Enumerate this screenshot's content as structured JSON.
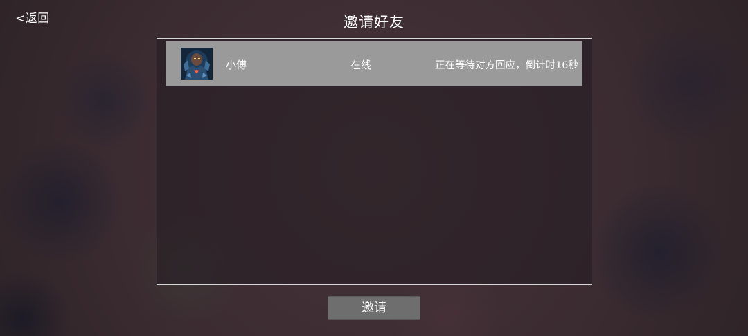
{
  "header": {
    "back_label": "<返回",
    "title": "邀请好友"
  },
  "friends": [
    {
      "avatar_icon": "armored-warrior-portrait-icon",
      "name": "小傅",
      "status": "在线",
      "invite_state": "正在等待对方回应，倒计时16秒"
    }
  ],
  "footer": {
    "invite_label": "邀请"
  },
  "colors": {
    "row_background": "#9a9a9a",
    "button_background": "#6e6e6e",
    "divider": "#d8d8d8",
    "text": "#ffffff"
  }
}
